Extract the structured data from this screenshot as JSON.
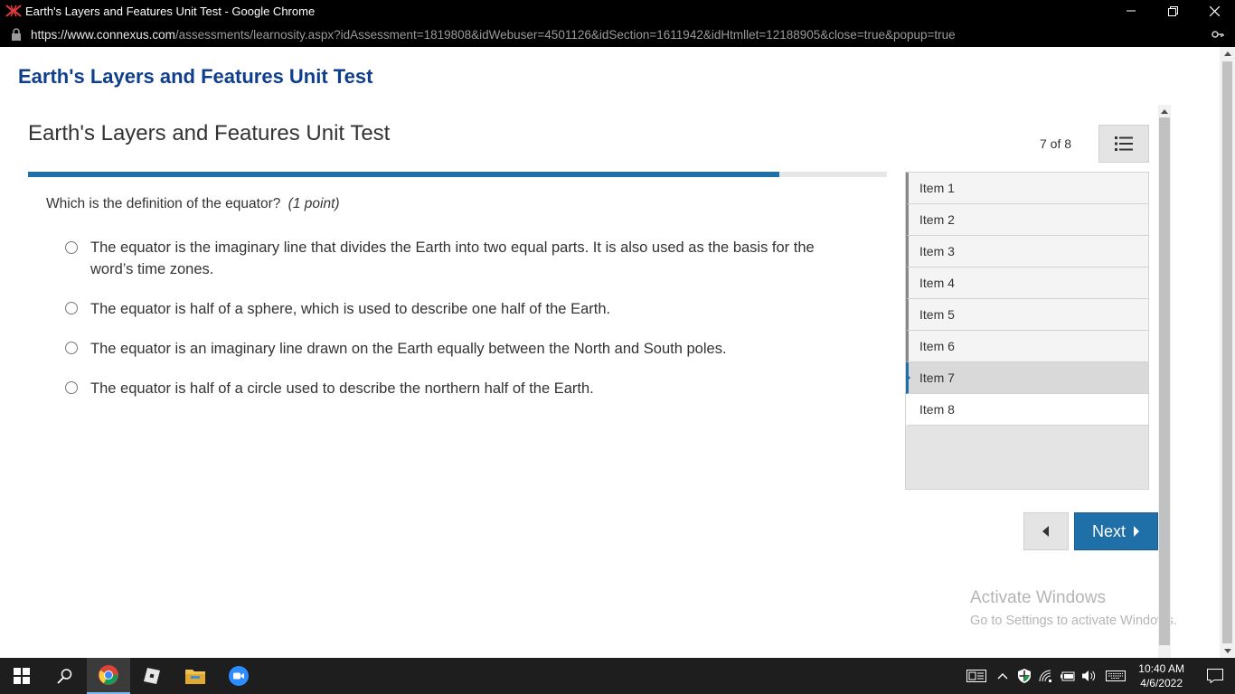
{
  "window": {
    "title": "Earth's Layers and Features Unit Test - Google Chrome",
    "url_host": "https://www.connexus.com",
    "url_path": "/assessments/learnosity.aspx?idAssessment=1819808&idWebuser=4501126&idSection=1611942&idHtmllet=12188905&close=true&popup=true"
  },
  "page": {
    "header": "Earth's Layers and Features Unit Test",
    "test_title": "Earth's Layers and Features Unit Test",
    "progress_fraction": 0.875,
    "counter": "7 of 8"
  },
  "question": {
    "text": "Which is the definition of the equator?",
    "points": "(1 point)",
    "options": [
      "The equator is the imaginary line that divides the Earth into two equal parts. It is also used as the basis for the word’s time zones.",
      "The equator is half of a sphere, which is used to describe one half of the Earth.",
      "The equator is an imaginary line drawn on the Earth equally between the North and South poles.",
      "The equator is half of a circle used to describe the northern half of the Earth."
    ]
  },
  "items": [
    "Item 1",
    "Item 2",
    "Item 3",
    "Item 4",
    "Item 5",
    "Item 6",
    "Item 7",
    "Item 8"
  ],
  "current_item": 7,
  "nav": {
    "next_label": "Next"
  },
  "watermark": {
    "line1": "Activate Windows",
    "line2": "Go to Settings to activate Windows."
  },
  "taskbar": {
    "time": "10:40 AM",
    "date": "4/6/2022"
  },
  "colors": {
    "accent": "#1f6fa8",
    "header_blue": "#0f3f8c"
  }
}
